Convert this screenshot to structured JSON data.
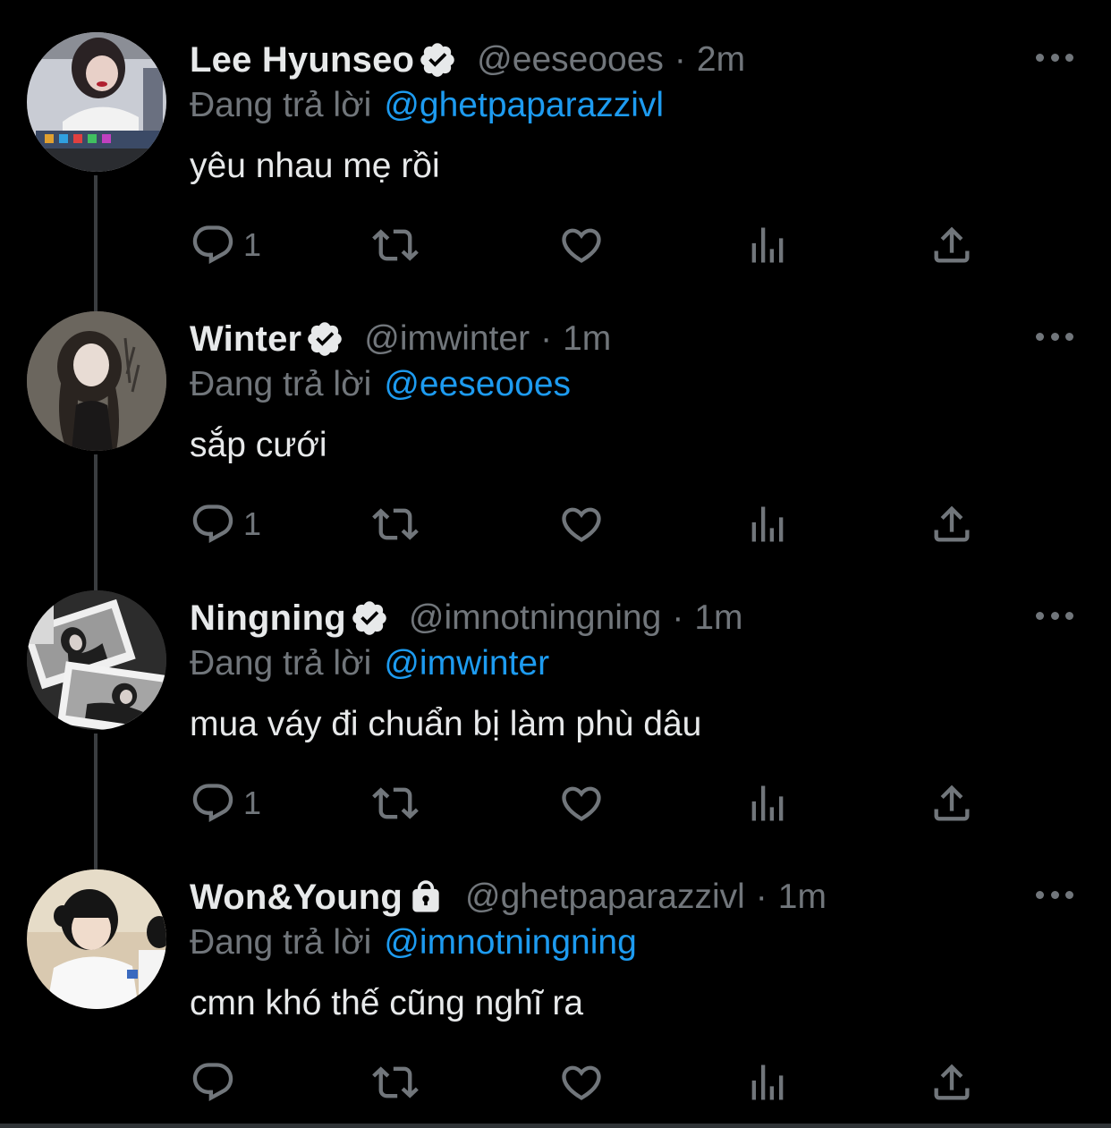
{
  "theme": {
    "background": "#000000",
    "text_primary": "#e7e9ea",
    "text_secondary": "#71767b",
    "accent": "#1d9bf0",
    "thread_line": "#3a3d40"
  },
  "tweets": [
    {
      "name": "Lee Hyunseo",
      "badge": "verified-icon",
      "handle": "@eeseooes",
      "separator": "·",
      "time": "2m",
      "reply_label": "Đang trả lời",
      "reply_to": "@ghetpaparazzivl",
      "text": "yêu nhau mẹ rồi",
      "reply_count": "1"
    },
    {
      "name": "Winter",
      "badge": "verified-icon",
      "handle": "@imwinter",
      "separator": "·",
      "time": "1m",
      "reply_label": "Đang trả lời",
      "reply_to": "@eeseooes",
      "text": "sắp cưới",
      "reply_count": "1"
    },
    {
      "name": "Ningning",
      "badge": "verified-icon",
      "handle": "@imnotningning",
      "separator": "·",
      "time": "1m",
      "reply_label": "Đang trả lời",
      "reply_to": "@imwinter",
      "text": "mua váy đi chuẩn bị làm phù dâu",
      "reply_count": "1"
    },
    {
      "name": "Won&Young",
      "badge": "lock-icon",
      "handle": "@ghetpaparazzivl",
      "separator": "·",
      "time": "1m",
      "reply_label": "Đang trả lời",
      "reply_to": "@imnotningning",
      "text": "cmn khó thế cũng nghĩ ra",
      "reply_count": ""
    }
  ]
}
